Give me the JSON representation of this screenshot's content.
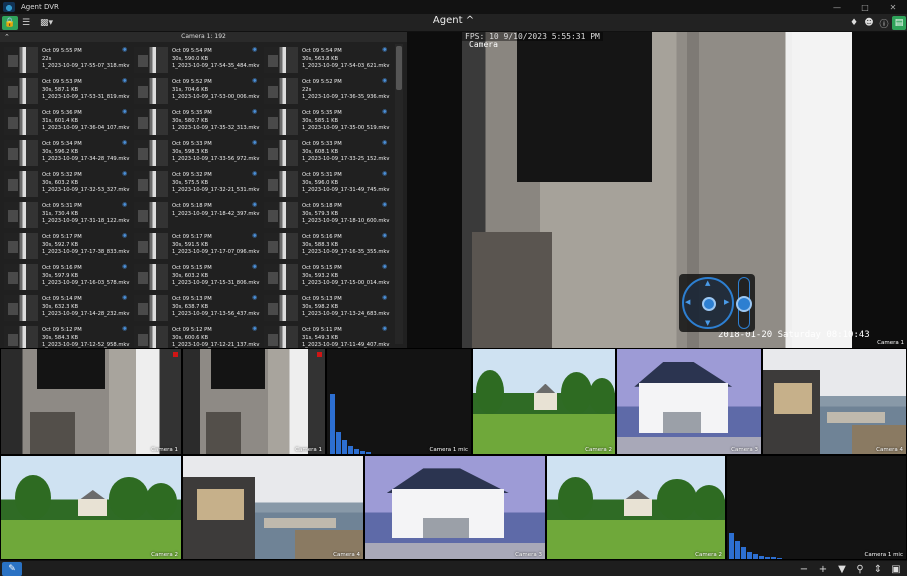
{
  "app": {
    "title": "Agent DVR"
  },
  "toolbar": {
    "view_title": "Agent",
    "view_chevron": "^"
  },
  "recordings": {
    "header": "Camera 1: 192",
    "items": [
      {
        "time": "Oct 09 5:55 PM",
        "size": "22s",
        "file": "1_2023-10-09_17-55-07_318.mkv"
      },
      {
        "time": "Oct 09 5:54 PM",
        "size": "30s, 590.0 KB",
        "file": "1_2023-10-09_17-54-35_484.mkv"
      },
      {
        "time": "Oct 09 5:54 PM",
        "size": "30s, 563.8 KB",
        "file": "1_2023-10-09_17-54-03_621.mkv"
      },
      {
        "time": "Oct 09 5:53 PM",
        "size": "30s, 587.1 KB",
        "file": "1_2023-10-09_17-53-31_819.mkv"
      },
      {
        "time": "Oct 09 5:52 PM",
        "size": "31s, 704.6 KB",
        "file": "1_2023-10-09_17-53-00_006.mkv"
      },
      {
        "time": "Oct 09 5:52 PM",
        "size": "22s",
        "file": "1_2023-10-09_17-36-35_936.mkv"
      },
      {
        "time": "Oct 09 5:36 PM",
        "size": "31s, 601.4 KB",
        "file": "1_2023-10-09_17-36-04_107.mkv"
      },
      {
        "time": "Oct 09 5:35 PM",
        "size": "30s, 580.7 KB",
        "file": "1_2023-10-09_17-35-32_313.mkv"
      },
      {
        "time": "Oct 09 5:35 PM",
        "size": "30s, 585.1 KB",
        "file": "1_2023-10-09_17-35-00_519.mkv"
      },
      {
        "time": "Oct 09 5:34 PM",
        "size": "30s, 596.2 KB",
        "file": "1_2023-10-09_17-34-28_749.mkv"
      },
      {
        "time": "Oct 09 5:33 PM",
        "size": "30s, 598.3 KB",
        "file": "1_2023-10-09_17-33-56_972.mkv"
      },
      {
        "time": "Oct 09 5:33 PM",
        "size": "30s, 608.1 KB",
        "file": "1_2023-10-09_17-33-25_152.mkv"
      },
      {
        "time": "Oct 09 5:32 PM",
        "size": "30s, 603.2 KB",
        "file": "1_2023-10-09_17-32-53_327.mkv"
      },
      {
        "time": "Oct 09 5:32 PM",
        "size": "30s, 575.5 KB",
        "file": "1_2023-10-09_17-32-21_531.mkv"
      },
      {
        "time": "Oct 09 5:31 PM",
        "size": "30s, 596.0 KB",
        "file": "1_2023-10-09_17-31-49_745.mkv"
      },
      {
        "time": "Oct 09 5:31 PM",
        "size": "31s, 730.4 KB",
        "file": "1_2023-10-09_17-31-18_122.mkv"
      },
      {
        "time": "Oct 09 5:18 PM",
        "size": "",
        "file": "1_2023-10-09_17-18-42_397.mkv"
      },
      {
        "time": "Oct 09 5:18 PM",
        "size": "30s, 579.3 KB",
        "file": "1_2023-10-09_17-18-10_600.mkv"
      },
      {
        "time": "Oct 09 5:17 PM",
        "size": "30s, 592.7 KB",
        "file": "1_2023-10-09_17-17-38_833.mkv"
      },
      {
        "time": "Oct 09 5:17 PM",
        "size": "30s, 591.5 KB",
        "file": "1_2023-10-09_17-17-07_096.mkv"
      },
      {
        "time": "Oct 09 5:16 PM",
        "size": "30s, 588.3 KB",
        "file": "1_2023-10-09_17-16-35_355.mkv"
      },
      {
        "time": "Oct 09 5:16 PM",
        "size": "30s, 597.9 KB",
        "file": "1_2023-10-09_17-16-03_578.mkv"
      },
      {
        "time": "Oct 09 5:15 PM",
        "size": "30s, 603.2 KB",
        "file": "1_2023-10-09_17-15-31_806.mkv"
      },
      {
        "time": "Oct 09 5:15 PM",
        "size": "30s, 593.2 KB",
        "file": "1_2023-10-09_17-15-00_014.mkv"
      },
      {
        "time": "Oct 09 5:14 PM",
        "size": "30s, 632.3 KB",
        "file": "1_2023-10-09_17-14-28_232.mkv"
      },
      {
        "time": "Oct 09 5:13 PM",
        "size": "30s, 638.7 KB",
        "file": "1_2023-10-09_17-13-56_437.mkv"
      },
      {
        "time": "Oct 09 5:13 PM",
        "size": "30s, 598.2 KB",
        "file": "1_2023-10-09_17-13-24_683.mkv"
      },
      {
        "time": "Oct 09 5:12 PM",
        "size": "30s, 584.3 KB",
        "file": "1_2023-10-09_17-12-52_958.mkv"
      },
      {
        "time": "Oct 09 5:12 PM",
        "size": "30s, 600.6 KB",
        "file": "1_2023-10-09_17-12-21_137.mkv"
      },
      {
        "time": "Oct 09 5:11 PM",
        "size": "31s, 549.3 KB",
        "file": "1_2023-10-09_17-11-49_407.mkv"
      }
    ]
  },
  "main_view": {
    "fps_text": "FPS: 10 9/10/2023 5:55:31 PM",
    "cam_overlay": "Camera",
    "timestamp_overlay": "2018-01-20 Saturday 08:10:43",
    "label": "Camera 1"
  },
  "tiles": {
    "row1": [
      "Camera 1",
      "Camera 1",
      "Camera 1 mic",
      "Camera 2",
      "Camera 3",
      "Camera 4"
    ],
    "row2": [
      "Camera 2",
      "Camera 4",
      "Camera 3",
      "Camera 2",
      "Camera 1 mic"
    ]
  },
  "colors": {
    "accent_green": "#2fa35a",
    "accent_blue": "#2a72c4",
    "rec_red": "#d01515"
  }
}
